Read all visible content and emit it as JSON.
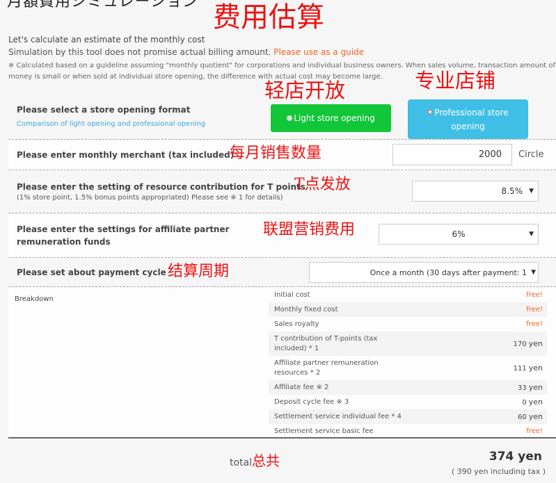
{
  "header": {
    "title": "月額費用シミュレーション",
    "annotation": "费用估算"
  },
  "intro": {
    "line1": "Let's calculate an estimate of the monthly cost",
    "line2": "Simulation by this tool does not promise actual billing amount.",
    "line2_highlight": "Please use as a guide",
    "note": "※ Calculated based on a guideline assuming \"monthly quotient\" for corporations and individual business owners. When sales volume, transaction amount of money is small or when sold at individual store opening, the difference with actual cost may become large."
  },
  "store_format": {
    "label": "Please select a store opening format",
    "link": "Comparison of light opening and professional opening",
    "options": [
      {
        "label": "Light store opening",
        "annotation": "轻店开放",
        "color": "#12c63a"
      },
      {
        "label": "Professional store opening",
        "annotation": "专业店铺",
        "color": "#40bfe6",
        "selected": true
      }
    ]
  },
  "monthly_merchant": {
    "label": "Please enter monthly merchant (tax included)",
    "annotation": "每月销售数量",
    "value": "2000",
    "unit": "Circle"
  },
  "t_points": {
    "label": "Please enter the setting of resource contribution for T points",
    "sub": "(1% store point, 1.5% bonus points appropriated) Please see ※ 1 for details)",
    "annotation": "T点发放",
    "value": "8.5%"
  },
  "affiliate": {
    "label": "Please enter the settings for affiliate partner remuneration funds",
    "annotation": "联盟营销费用",
    "value": "6%"
  },
  "payment_cycle": {
    "label": "Please set about payment cycle",
    "annotation": "结算周期",
    "value": "Once a month (30 days after payment: 1"
  },
  "breakdown": {
    "title": "Breakdown",
    "rows": [
      {
        "name": "Initial cost",
        "value": "free!",
        "free": true
      },
      {
        "name": "Monthly fixed cost",
        "value": "free!",
        "free": true
      },
      {
        "name": "Sales royalty",
        "value": "free!",
        "free": true
      },
      {
        "name": "T contribution of T-points (tax included) * 1",
        "value": "170",
        "unit": "yen"
      },
      {
        "name": "Affiliate partner remuneration resources * 2",
        "value": "111",
        "unit": "yen"
      },
      {
        "name": "Affiliate fee ※ 2",
        "value": "33",
        "unit": "yen"
      },
      {
        "name": "Deposit cycle fee ※ 3",
        "value": "0",
        "unit": "yen"
      },
      {
        "name": "Settlement service individual fee * 4",
        "value": "60",
        "unit": "yen"
      },
      {
        "name": "Settlement service basic fee",
        "value": "free!",
        "free": true
      }
    ]
  },
  "total": {
    "label": "total",
    "annotation": "总共",
    "value": "374 yen",
    "tax_prefix": "(",
    "tax_value": "390",
    "tax_suffix": "yen including tax )"
  },
  "colors": {
    "accent_orange": "#f26522",
    "light_green": "#12c63a",
    "pro_blue": "#40bfe6",
    "annotation_red": "#ee1111"
  }
}
